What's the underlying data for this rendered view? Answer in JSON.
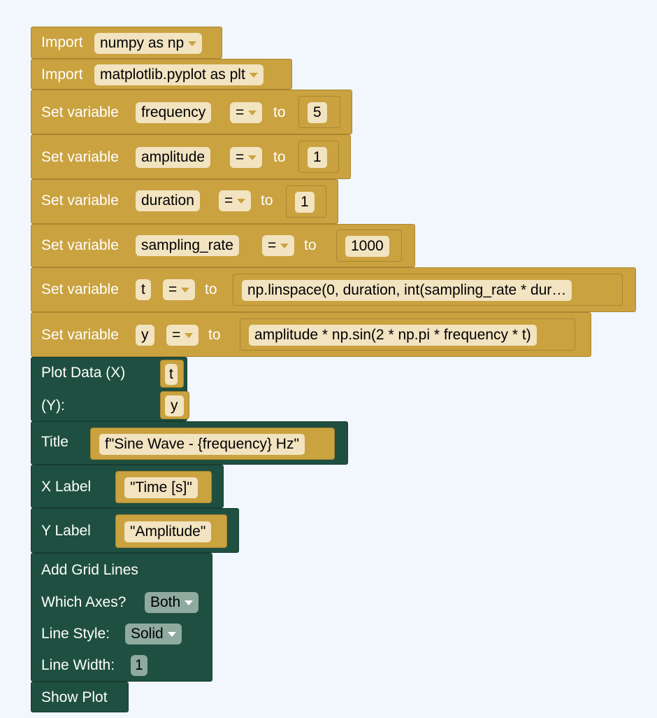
{
  "blocks": {
    "import1": {
      "label": "Import",
      "value": "numpy as np"
    },
    "import2": {
      "label": "Import",
      "value": "matplotlib.pyplot as plt"
    },
    "set_label": "Set variable",
    "op": "=",
    "to": "to",
    "vars": [
      {
        "name": "frequency",
        "value": "5"
      },
      {
        "name": "amplitude",
        "value": "1"
      },
      {
        "name": "duration",
        "value": "1"
      },
      {
        "name": "sampling_rate",
        "value": "1000"
      },
      {
        "name": "t",
        "value": "np.linspace(0, duration, int(sampling_rate * dur…"
      },
      {
        "name": "y",
        "value": "amplitude * np.sin(2 * np.pi * frequency * t)"
      }
    ],
    "plot": {
      "label_x": "Plot Data (X)",
      "label_y": "(Y):",
      "x": "t",
      "y": "y"
    },
    "title": {
      "label": "Title",
      "value": "f\"Sine Wave - {frequency} Hz\""
    },
    "xlabel": {
      "label": "X Label",
      "value": "\"Time [s]\""
    },
    "ylabel": {
      "label": "Y Label",
      "value": "\"Amplitude\""
    },
    "grid": {
      "label": "Add Grid Lines",
      "axes_label": "Which Axes?",
      "axes_value": "Both",
      "style_label": "Line Style:",
      "style_value": "Solid",
      "width_label": "Line Width:",
      "width_value": "1"
    },
    "show": {
      "label": "Show Plot"
    }
  },
  "colors": {
    "gold": "#caa23f",
    "green": "#1f4f40",
    "background": "#f1f7fd"
  }
}
